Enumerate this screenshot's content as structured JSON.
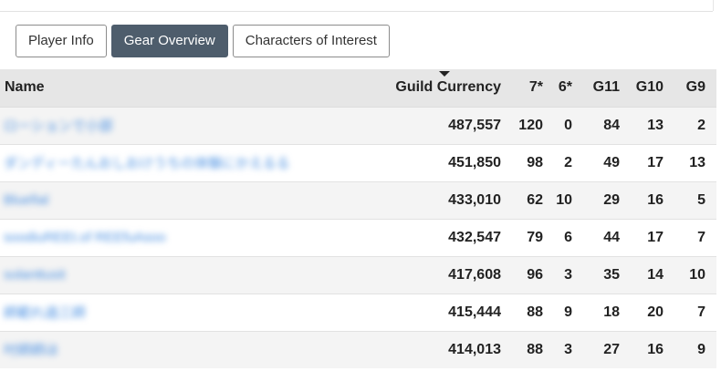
{
  "tabs": [
    {
      "label": "Player Info",
      "active": false
    },
    {
      "label": "Gear Overview",
      "active": true
    },
    {
      "label": "Characters of Interest",
      "active": false
    }
  ],
  "table": {
    "sort_column": "Guild Currency",
    "sort_direction": "descending",
    "headers": [
      "Name",
      "Guild Currency",
      "7*",
      "6*",
      "G11",
      "G10",
      "G9"
    ],
    "rows": [
      {
        "name": "ローションで小部",
        "currency": "487,557",
        "s7": "120",
        "s6": "0",
        "g11": "84",
        "g10": "13",
        "g9": "2"
      },
      {
        "name": "ダンディーたんおしおけうちの体験にかえるる",
        "currency": "451,850",
        "s7": "98",
        "s6": "2",
        "g11": "49",
        "g10": "17",
        "g9": "13"
      },
      {
        "name": "Bluefial",
        "currency": "433,010",
        "s7": "62",
        "s6": "10",
        "g11": "29",
        "g10": "16",
        "g9": "5"
      },
      {
        "name": "soodiuREEt.of REEfuAsoo",
        "currency": "432,547",
        "s7": "79",
        "s6": "6",
        "g11": "44",
        "g10": "17",
        "g9": "7"
      },
      {
        "name": "solanttusit",
        "currency": "417,608",
        "s7": "96",
        "s6": "3",
        "g11": "35",
        "g10": "14",
        "g9": "10"
      },
      {
        "name": "師範れ過三師",
        "currency": "415,444",
        "s7": "88",
        "s6": "9",
        "g11": "18",
        "g10": "20",
        "g9": "7"
      },
      {
        "name": "吋師師ほ",
        "currency": "414,013",
        "s7": "88",
        "s6": "3",
        "g11": "27",
        "g10": "16",
        "g9": "9"
      }
    ]
  },
  "colors": {
    "active_tab": "#4e5d6c",
    "header_bg": "#e6e6e6",
    "stripe_bg": "#f4f4f4",
    "link": "#4a90e2"
  }
}
